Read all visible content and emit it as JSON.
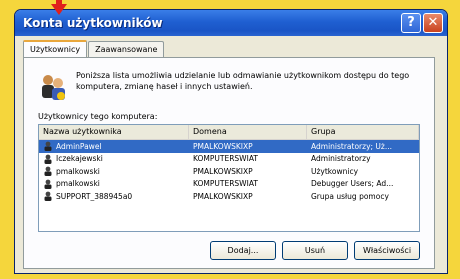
{
  "window": {
    "title": "Konta użytkowników"
  },
  "tabs": [
    {
      "label": "Użytkownicy"
    },
    {
      "label": "Zaawansowane"
    }
  ],
  "description": "Poniższa lista umożliwia udzielanie lub odmawianie użytkownikom dostępu do tego komputera, zmianę haseł i innych ustawień.",
  "users_label": "Użytkownicy tego komputera:",
  "table": {
    "columns": [
      "Nazwa użytkownika",
      "Domena",
      "Grupa"
    ],
    "rows": [
      {
        "name": "AdminPawel",
        "domain": "PMALKOWSKIXP",
        "group": "Administratorzy; Uż..."
      },
      {
        "name": "Iczekajewski",
        "domain": "KOMPUTERSWIAT",
        "group": "Administratorzy"
      },
      {
        "name": "pmalkowski",
        "domain": "PMALKOWSKIXP",
        "group": "Użytkownicy"
      },
      {
        "name": "pmalkowski",
        "domain": "KOMPUTERSWIAT",
        "group": "Debugger Users; Ad..."
      },
      {
        "name": "SUPPORT_388945a0",
        "domain": "PMALKOWSKIXP",
        "group": "Grupa usług pomocy"
      }
    ],
    "selected_index": 0
  },
  "buttons": {
    "add": "Dodaj...",
    "remove": "Usuń",
    "properties": "Właściwości"
  },
  "colors": {
    "background": "#f5d63c",
    "titlebar": "#1f5fd1",
    "selection": "#316ac5",
    "arrow": "#e0201c"
  }
}
